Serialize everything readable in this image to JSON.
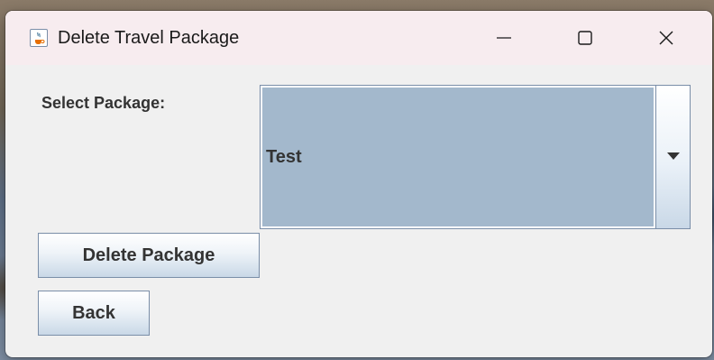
{
  "window": {
    "title": "Delete Travel Package",
    "icon": "java-cup-icon",
    "controls": {
      "minimize": "minimize-icon",
      "maximize": "maximize-icon",
      "close": "close-icon"
    }
  },
  "form": {
    "select_label": "Select Package:",
    "package_combo": {
      "selected": "Test",
      "arrow_icon": "chevron-down-icon"
    },
    "delete_button_label": "Delete Package",
    "back_button_label": "Back"
  },
  "colors": {
    "titlebar": "#f7ecef",
    "window_bg": "#f0f0f0",
    "selection": "#a3b8cc",
    "border": "#7a8ea8"
  }
}
